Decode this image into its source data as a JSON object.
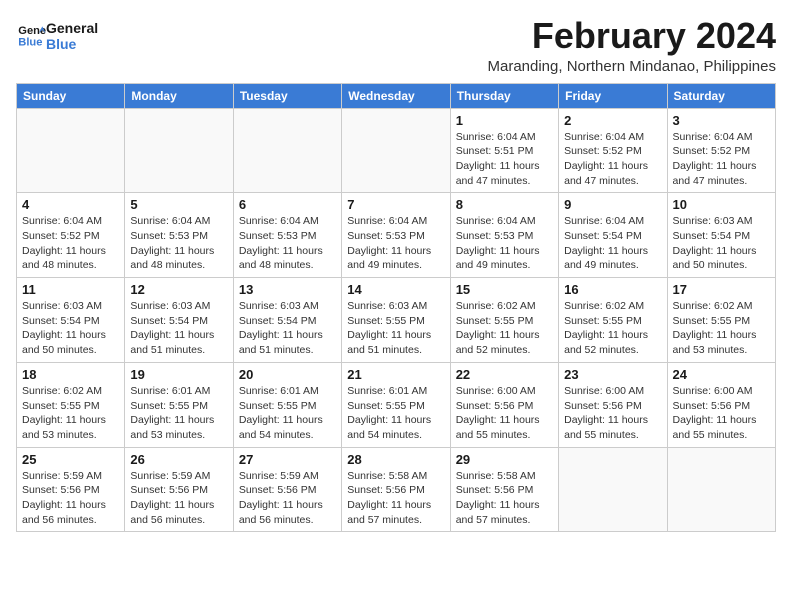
{
  "logo": {
    "line1": "General",
    "line2": "Blue"
  },
  "title": "February 2024",
  "location": "Maranding, Northern Mindanao, Philippines",
  "weekdays": [
    "Sunday",
    "Monday",
    "Tuesday",
    "Wednesday",
    "Thursday",
    "Friday",
    "Saturday"
  ],
  "weeks": [
    [
      {
        "day": "",
        "info": ""
      },
      {
        "day": "",
        "info": ""
      },
      {
        "day": "",
        "info": ""
      },
      {
        "day": "",
        "info": ""
      },
      {
        "day": "1",
        "info": "Sunrise: 6:04 AM\nSunset: 5:51 PM\nDaylight: 11 hours and 47 minutes."
      },
      {
        "day": "2",
        "info": "Sunrise: 6:04 AM\nSunset: 5:52 PM\nDaylight: 11 hours and 47 minutes."
      },
      {
        "day": "3",
        "info": "Sunrise: 6:04 AM\nSunset: 5:52 PM\nDaylight: 11 hours and 47 minutes."
      }
    ],
    [
      {
        "day": "4",
        "info": "Sunrise: 6:04 AM\nSunset: 5:52 PM\nDaylight: 11 hours and 48 minutes."
      },
      {
        "day": "5",
        "info": "Sunrise: 6:04 AM\nSunset: 5:53 PM\nDaylight: 11 hours and 48 minutes."
      },
      {
        "day": "6",
        "info": "Sunrise: 6:04 AM\nSunset: 5:53 PM\nDaylight: 11 hours and 48 minutes."
      },
      {
        "day": "7",
        "info": "Sunrise: 6:04 AM\nSunset: 5:53 PM\nDaylight: 11 hours and 49 minutes."
      },
      {
        "day": "8",
        "info": "Sunrise: 6:04 AM\nSunset: 5:53 PM\nDaylight: 11 hours and 49 minutes."
      },
      {
        "day": "9",
        "info": "Sunrise: 6:04 AM\nSunset: 5:54 PM\nDaylight: 11 hours and 49 minutes."
      },
      {
        "day": "10",
        "info": "Sunrise: 6:03 AM\nSunset: 5:54 PM\nDaylight: 11 hours and 50 minutes."
      }
    ],
    [
      {
        "day": "11",
        "info": "Sunrise: 6:03 AM\nSunset: 5:54 PM\nDaylight: 11 hours and 50 minutes."
      },
      {
        "day": "12",
        "info": "Sunrise: 6:03 AM\nSunset: 5:54 PM\nDaylight: 11 hours and 51 minutes."
      },
      {
        "day": "13",
        "info": "Sunrise: 6:03 AM\nSunset: 5:54 PM\nDaylight: 11 hours and 51 minutes."
      },
      {
        "day": "14",
        "info": "Sunrise: 6:03 AM\nSunset: 5:55 PM\nDaylight: 11 hours and 51 minutes."
      },
      {
        "day": "15",
        "info": "Sunrise: 6:02 AM\nSunset: 5:55 PM\nDaylight: 11 hours and 52 minutes."
      },
      {
        "day": "16",
        "info": "Sunrise: 6:02 AM\nSunset: 5:55 PM\nDaylight: 11 hours and 52 minutes."
      },
      {
        "day": "17",
        "info": "Sunrise: 6:02 AM\nSunset: 5:55 PM\nDaylight: 11 hours and 53 minutes."
      }
    ],
    [
      {
        "day": "18",
        "info": "Sunrise: 6:02 AM\nSunset: 5:55 PM\nDaylight: 11 hours and 53 minutes."
      },
      {
        "day": "19",
        "info": "Sunrise: 6:01 AM\nSunset: 5:55 PM\nDaylight: 11 hours and 53 minutes."
      },
      {
        "day": "20",
        "info": "Sunrise: 6:01 AM\nSunset: 5:55 PM\nDaylight: 11 hours and 54 minutes."
      },
      {
        "day": "21",
        "info": "Sunrise: 6:01 AM\nSunset: 5:55 PM\nDaylight: 11 hours and 54 minutes."
      },
      {
        "day": "22",
        "info": "Sunrise: 6:00 AM\nSunset: 5:56 PM\nDaylight: 11 hours and 55 minutes."
      },
      {
        "day": "23",
        "info": "Sunrise: 6:00 AM\nSunset: 5:56 PM\nDaylight: 11 hours and 55 minutes."
      },
      {
        "day": "24",
        "info": "Sunrise: 6:00 AM\nSunset: 5:56 PM\nDaylight: 11 hours and 55 minutes."
      }
    ],
    [
      {
        "day": "25",
        "info": "Sunrise: 5:59 AM\nSunset: 5:56 PM\nDaylight: 11 hours and 56 minutes."
      },
      {
        "day": "26",
        "info": "Sunrise: 5:59 AM\nSunset: 5:56 PM\nDaylight: 11 hours and 56 minutes."
      },
      {
        "day": "27",
        "info": "Sunrise: 5:59 AM\nSunset: 5:56 PM\nDaylight: 11 hours and 56 minutes."
      },
      {
        "day": "28",
        "info": "Sunrise: 5:58 AM\nSunset: 5:56 PM\nDaylight: 11 hours and 57 minutes."
      },
      {
        "day": "29",
        "info": "Sunrise: 5:58 AM\nSunset: 5:56 PM\nDaylight: 11 hours and 57 minutes."
      },
      {
        "day": "",
        "info": ""
      },
      {
        "day": "",
        "info": ""
      }
    ]
  ]
}
